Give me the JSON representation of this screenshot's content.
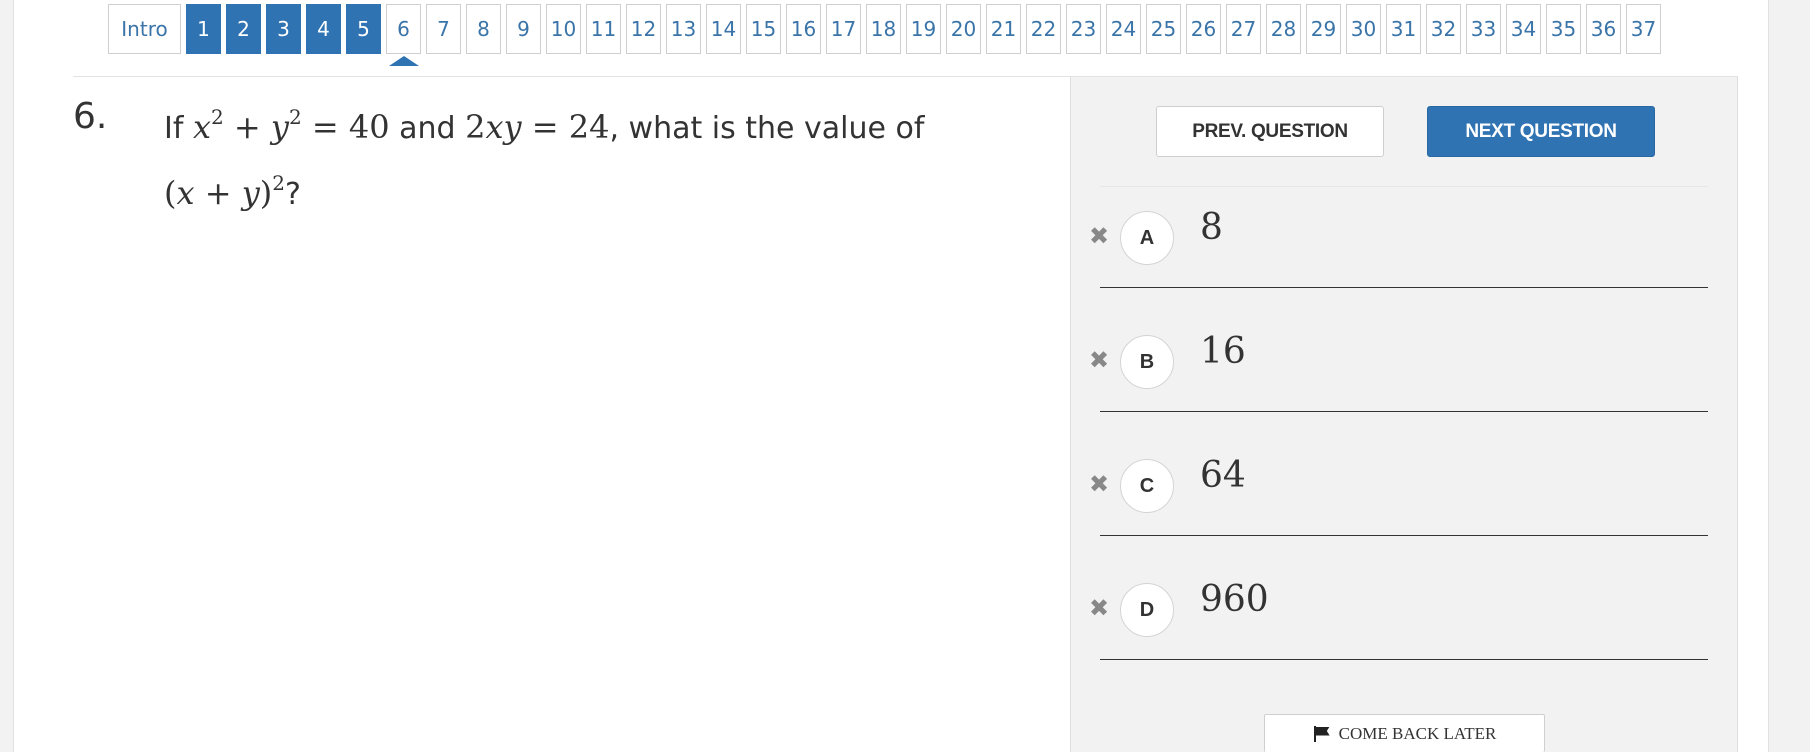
{
  "nav": {
    "intro_label": "Intro",
    "questions": [
      "1",
      "2",
      "3",
      "4",
      "5",
      "6",
      "7",
      "8",
      "9",
      "10",
      "11",
      "12",
      "13",
      "14",
      "15",
      "16",
      "17",
      "18",
      "19",
      "20",
      "21",
      "22",
      "23",
      "24",
      "25",
      "26",
      "27",
      "28",
      "29",
      "30",
      "31",
      "32",
      "33",
      "34",
      "35",
      "36",
      "37"
    ],
    "completed": [
      "1",
      "2",
      "3",
      "4",
      "5"
    ],
    "current": "6",
    "active_color": "#2f73b3"
  },
  "question": {
    "number": "6.",
    "text_prefix": "If",
    "eq1_x": "x",
    "eq1_exp1": "2",
    "eq1_plus": " + ",
    "eq1_y": "y",
    "eq1_exp2": "2",
    "eq1_rhs": " = 40",
    "connector": " and ",
    "eq2_coef": "2",
    "eq2_vars": "xy",
    "eq2_rhs": " = 24",
    "text_mid": ", what is the value of",
    "expr_open": "(",
    "expr_x": "x",
    "expr_plus": " + ",
    "expr_y": "y",
    "expr_close": ")",
    "expr_exp": "2",
    "text_end": "?"
  },
  "panel": {
    "prev_label": "PREV. QUESTION",
    "next_label": "NEXT QUESTION",
    "choices": [
      {
        "letter": "A",
        "value": "8"
      },
      {
        "letter": "B",
        "value": "16"
      },
      {
        "letter": "C",
        "value": "64"
      },
      {
        "letter": "D",
        "value": "960"
      }
    ],
    "eliminate_icon": "close-x-icon",
    "come_back_label": "COME BACK LATER",
    "come_back_icon": "flag-icon"
  }
}
